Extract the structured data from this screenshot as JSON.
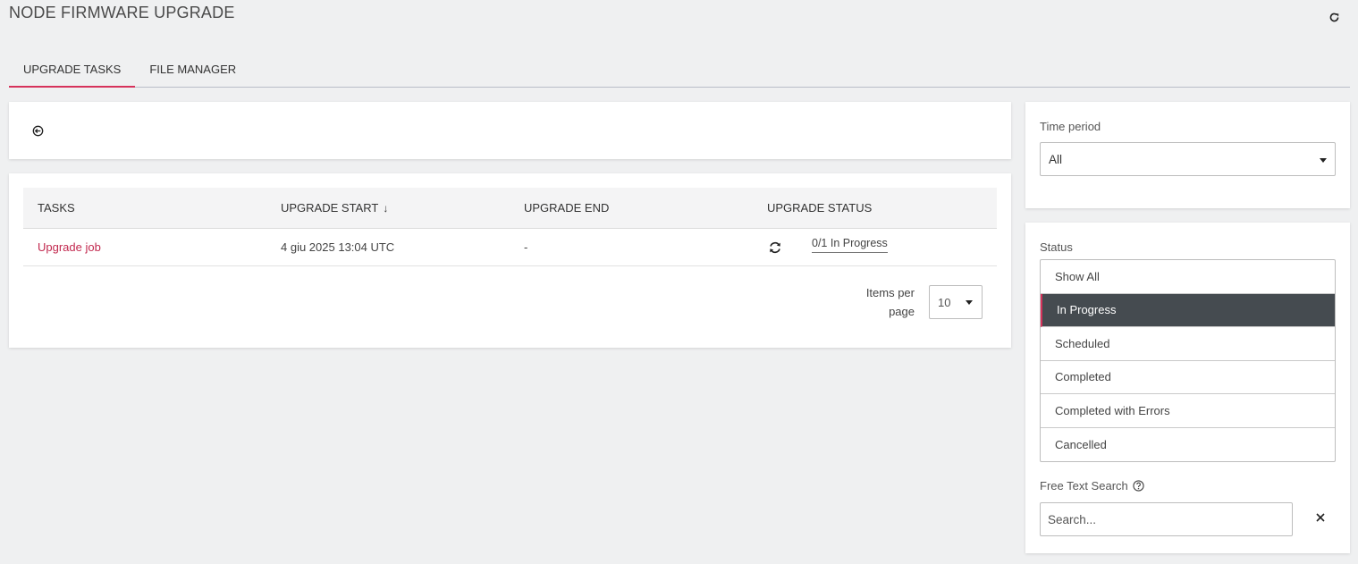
{
  "page": {
    "title": "NODE FIRMWARE UPGRADE"
  },
  "tabs": [
    {
      "label": "UPGRADE TASKS",
      "active": true
    },
    {
      "label": "FILE MANAGER",
      "active": false
    }
  ],
  "table": {
    "columns": [
      "TASKS",
      "UPGRADE START",
      "UPGRADE END",
      "UPGRADE STATUS"
    ],
    "sort_indicator": "↓",
    "rows": [
      {
        "task": "Upgrade job",
        "start": "4 giu 2025 13:04 UTC",
        "end": "-",
        "status": "0/1 In Progress"
      }
    ]
  },
  "pagination": {
    "label_line1": "Items per",
    "label_line2": "page",
    "value": "10"
  },
  "filters": {
    "time_period": {
      "label": "Time period",
      "value": "All"
    },
    "status": {
      "label": "Status",
      "options": [
        "Show All",
        "In Progress",
        "Scheduled",
        "Completed",
        "Completed with Errors",
        "Cancelled"
      ],
      "selected": "In Progress"
    },
    "search": {
      "label": "Free Text Search",
      "placeholder": "Search..."
    }
  },
  "icons": {
    "refresh": "refresh-icon",
    "collapse": "collapse-icon",
    "status": "sync-icon",
    "help": "help-circle-icon",
    "clear": "close-icon"
  },
  "colors": {
    "accent": "#d6325b",
    "link": "#c2294f",
    "selected_bg": "#454b50"
  }
}
